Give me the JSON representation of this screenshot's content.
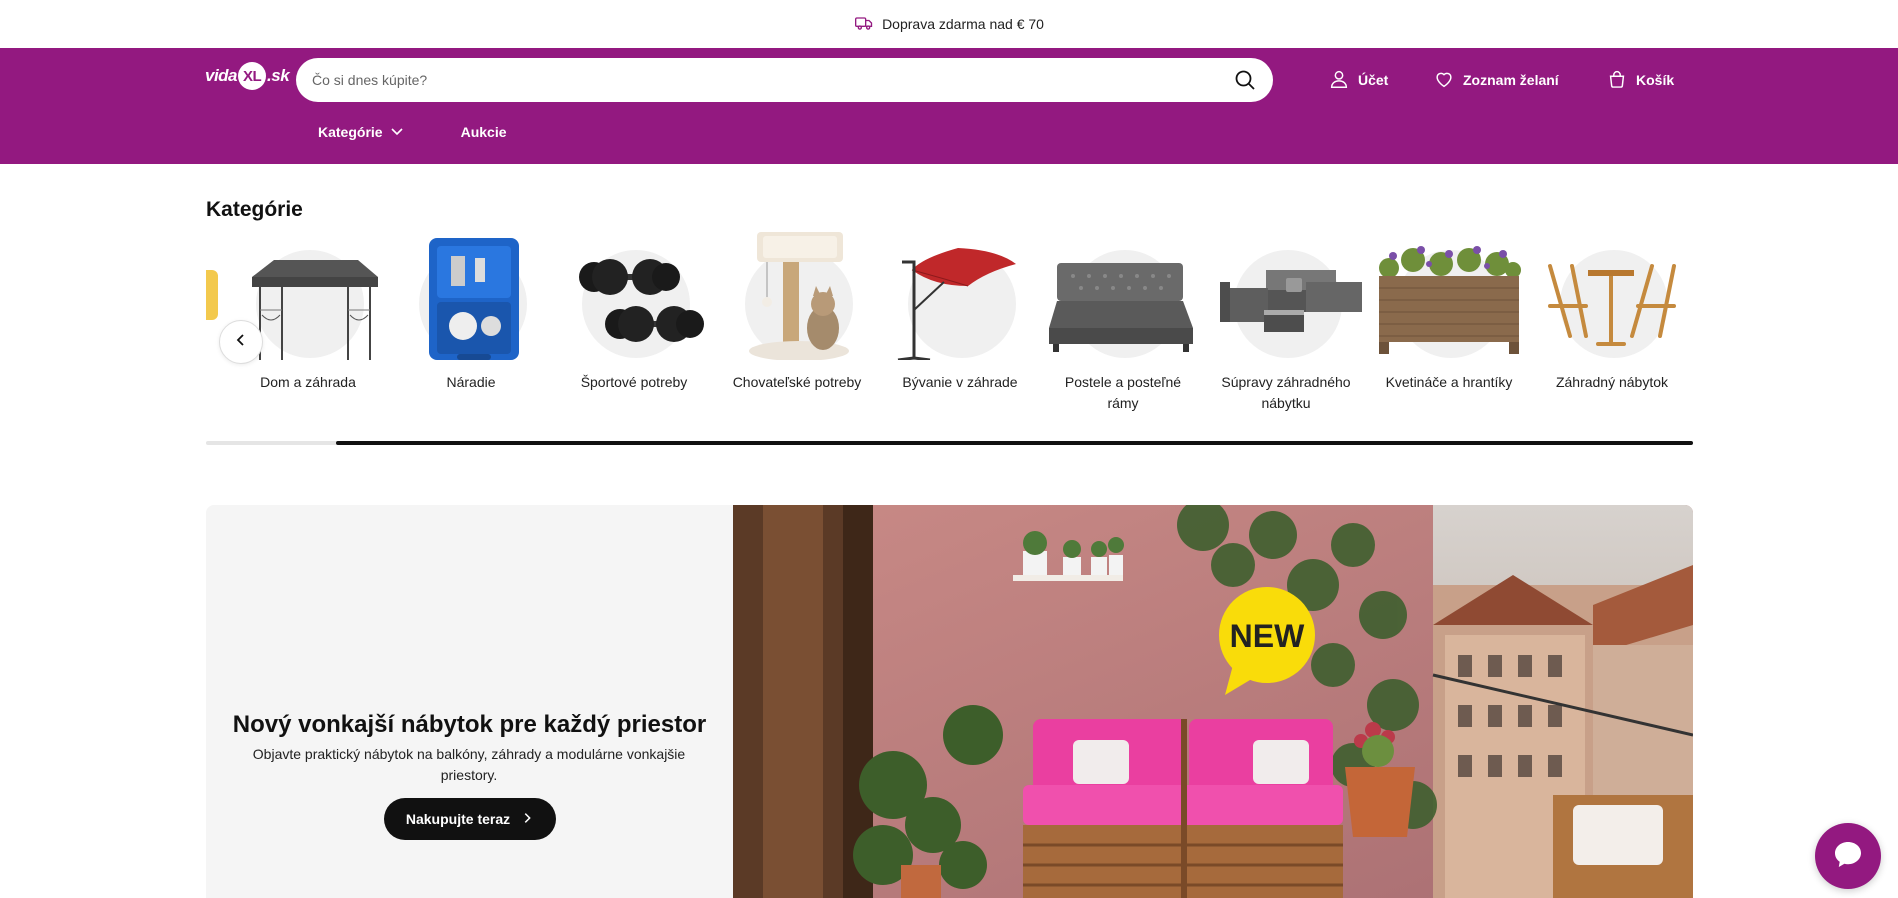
{
  "topbar": {
    "text": "Doprava zdarma nad € 70",
    "icon": "delivery-truck-icon"
  },
  "header": {
    "logo": {
      "pre": "vida",
      "mark": "XL",
      "post": ".sk"
    },
    "search": {
      "placeholder": "Čo si dnes kúpite?",
      "value": ""
    },
    "nav": {
      "account": "Účet",
      "wishlist": "Zoznam želaní",
      "cart": "Košík"
    },
    "subnav": {
      "categories": "Kategórie",
      "auctions": "Aukcie"
    },
    "brand_color": "#931980"
  },
  "categories": {
    "title": "Kategórie",
    "items": [
      {
        "label": "Dom a záhrada",
        "icon": "gazebo-icon"
      },
      {
        "label": "Náradie",
        "icon": "spray-gun-case-icon"
      },
      {
        "label": "Športové potreby",
        "icon": "dumbbells-icon"
      },
      {
        "label": "Chovateľské potreby",
        "icon": "cat-tree-icon"
      },
      {
        "label": "Bývanie v záhrade",
        "icon": "parasol-icon"
      },
      {
        "label": "Postele a posteľné rámy",
        "icon": "bed-icon"
      },
      {
        "label": "Súpravy záhradného nábytku",
        "icon": "garden-sofa-set-icon"
      },
      {
        "label": "Kvetináče a hrantíky",
        "icon": "planter-icon"
      },
      {
        "label": "Záhradný nábytok",
        "icon": "bistro-set-icon"
      }
    ]
  },
  "hero": {
    "title": "Nový vonkajší nábytok pre každý priestor",
    "subtitle": "Objavte praktický nábytok na balkóny, záhrady a modulárne vonkajšie priestory.",
    "button": "Nakupujte teraz",
    "badge": "NEW"
  }
}
